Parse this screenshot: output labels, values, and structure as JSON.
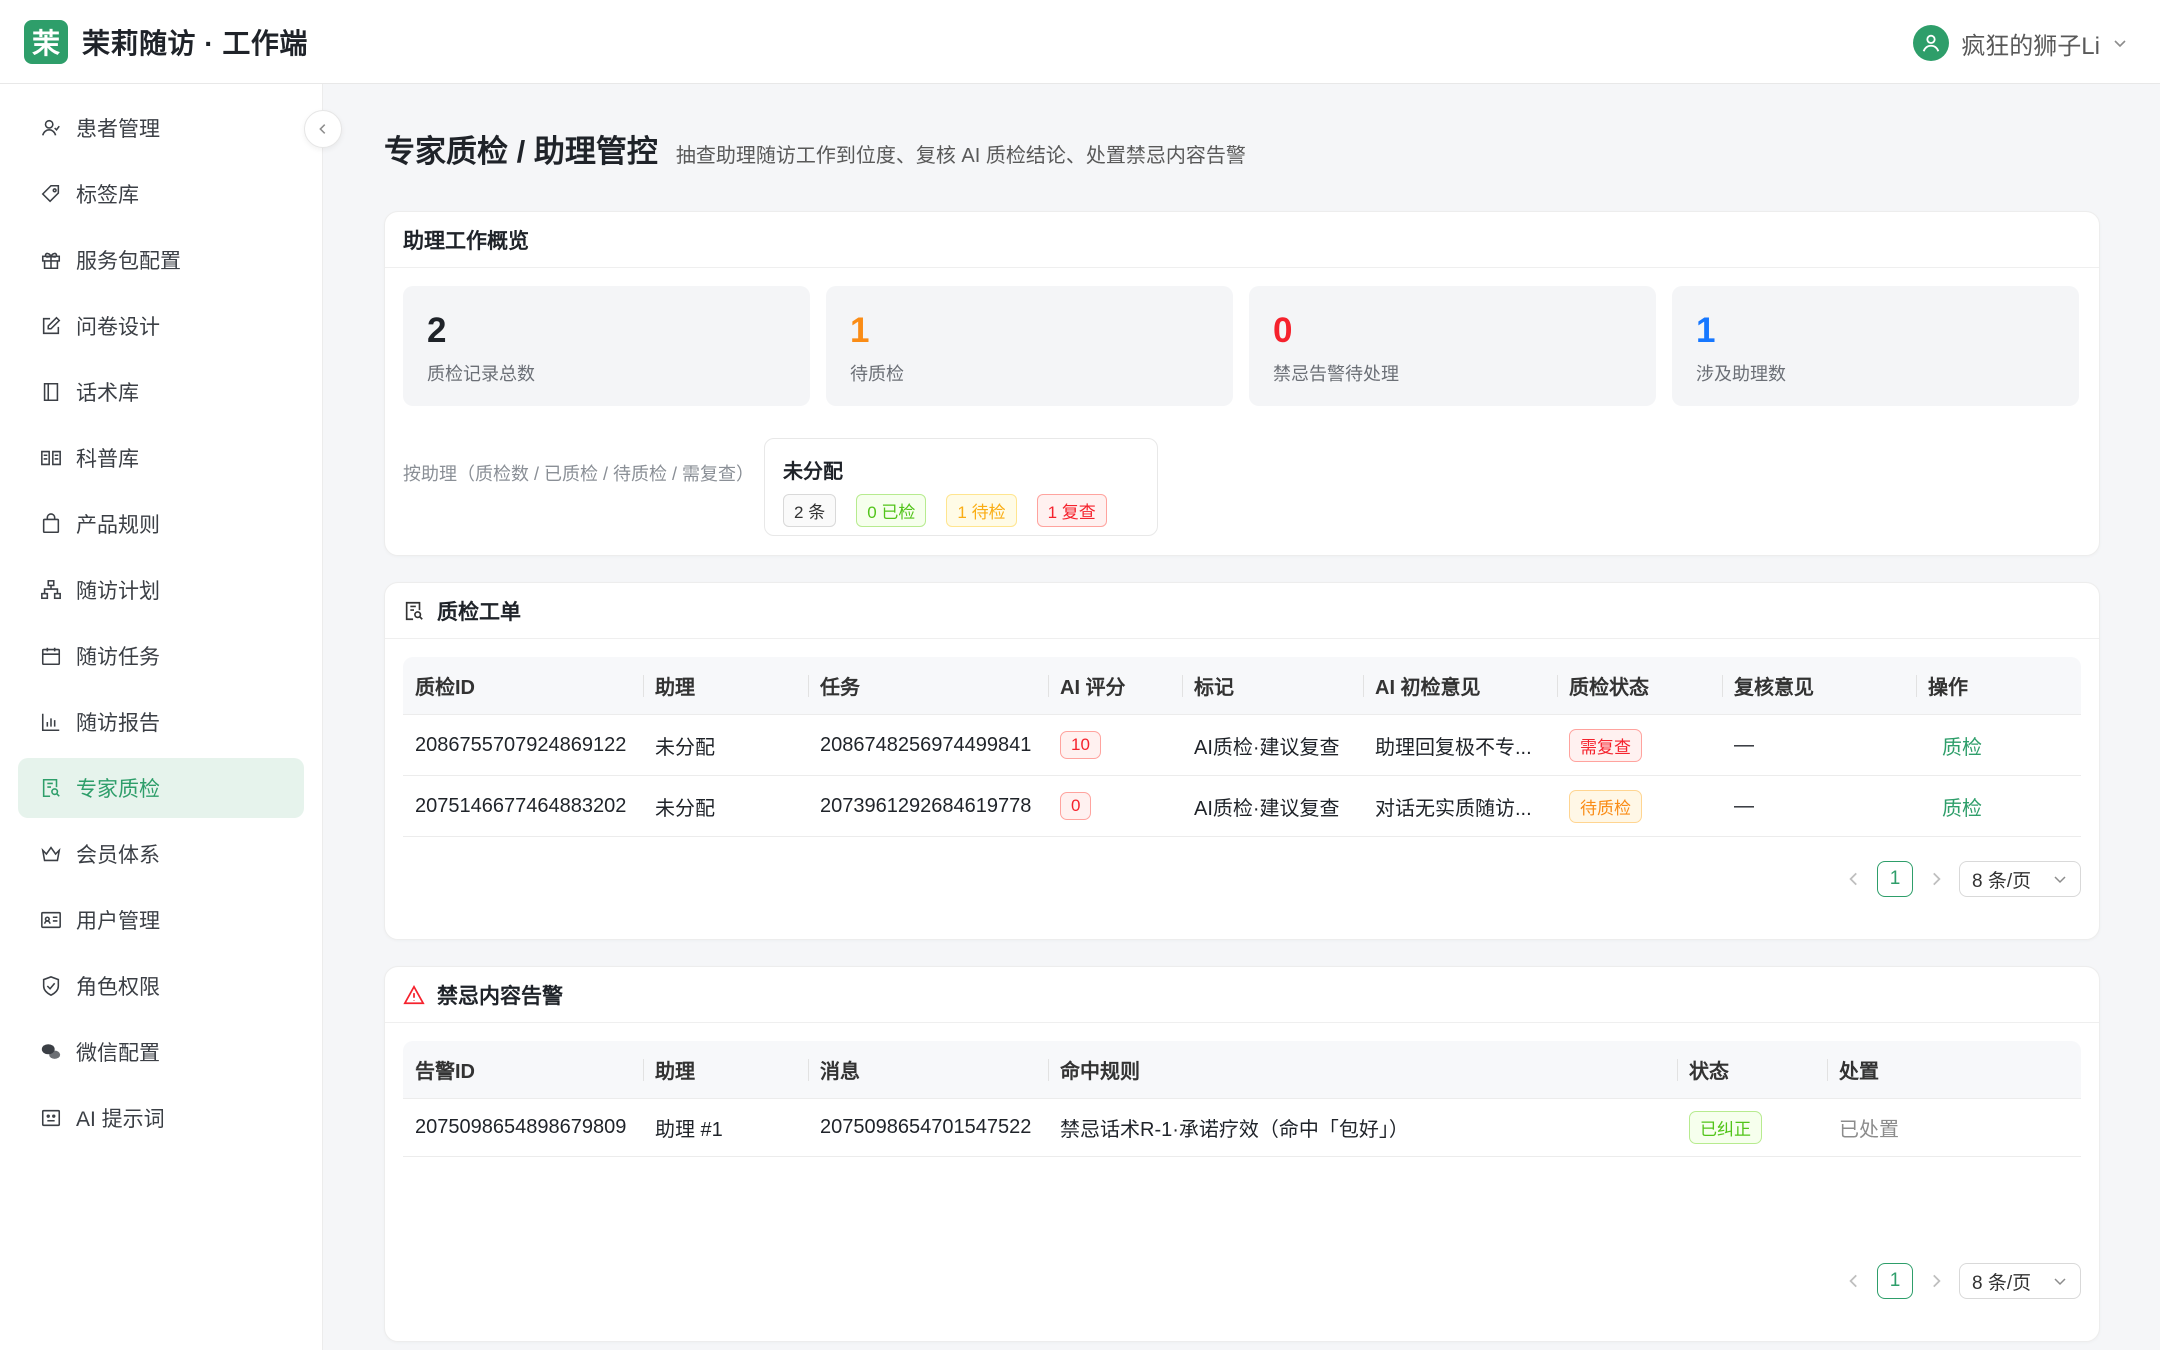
{
  "header": {
    "logo_char": "茉",
    "app_title": "茉莉随访 · 工作端",
    "user_name": "疯狂的狮子Li",
    "brand_color": "#2e9e6a"
  },
  "sidebar": {
    "items": [
      {
        "label": "患者管理",
        "icon": "patient-icon"
      },
      {
        "label": "标签库",
        "icon": "tag-icon"
      },
      {
        "label": "服务包配置",
        "icon": "gift-icon"
      },
      {
        "label": "问卷设计",
        "icon": "edit-icon"
      },
      {
        "label": "话术库",
        "icon": "book-icon"
      },
      {
        "label": "科普库",
        "icon": "read-icon"
      },
      {
        "label": "产品规则",
        "icon": "bag-icon"
      },
      {
        "label": "随访计划",
        "icon": "cluster-icon"
      },
      {
        "label": "随访任务",
        "icon": "calendar-icon"
      },
      {
        "label": "随访报告",
        "icon": "bar-chart-icon"
      },
      {
        "label": "专家质检",
        "icon": "audit-icon",
        "active": true
      },
      {
        "label": "会员体系",
        "icon": "crown-icon"
      },
      {
        "label": "用户管理",
        "icon": "idcard-icon"
      },
      {
        "label": "角色权限",
        "icon": "shield-icon"
      },
      {
        "label": "微信配置",
        "icon": "wechat-icon"
      },
      {
        "label": "AI 提示词",
        "icon": "robot-icon"
      }
    ]
  },
  "page": {
    "title": "专家质检 / 助理管控",
    "subtitle": "抽查助理随访工作到位度、复核 AI 质检结论、处置禁忌内容告警"
  },
  "overview": {
    "title": "助理工作概览",
    "stats": [
      {
        "value": "2",
        "label": "质检记录总数",
        "color": "#1f2329"
      },
      {
        "value": "1",
        "label": "待质检",
        "color": "#fa8c16"
      },
      {
        "value": "0",
        "label": "禁忌告警待处理",
        "color": "#f5222d"
      },
      {
        "value": "1",
        "label": "涉及助理数",
        "color": "#1677ff"
      }
    ],
    "by_assistant_label": "按助理（质检数 / 已质检 / 待质检 / 需复查）",
    "assistant": {
      "name": "未分配",
      "count": "2 条",
      "checked": "0 已检",
      "pending": "1 待检",
      "review": "1 复查"
    }
  },
  "qc_orders": {
    "title": "质检工单",
    "columns": [
      "质检ID",
      "助理",
      "任务",
      "AI 评分",
      "标记",
      "AI 初检意见",
      "质检状态",
      "复核意见",
      "操作"
    ],
    "rows": [
      {
        "id": "2086755707924869122",
        "assistant": "未分配",
        "task": "2086748256974499841",
        "score": "10",
        "mark": "AI质检·建议复查",
        "opinion": "助理回复极不专...",
        "status": "需复查",
        "status_type": "red",
        "review": "—",
        "action": "质检"
      },
      {
        "id": "2075146677464883202",
        "assistant": "未分配",
        "task": "2073961292684619778",
        "score": "0",
        "mark": "AI质检·建议复查",
        "opinion": "对话无实质随访...",
        "status": "待质检",
        "status_type": "orange",
        "review": "—",
        "action": "质检"
      }
    ],
    "pagination": {
      "page": "1",
      "page_size": "8 条/页"
    }
  },
  "alerts": {
    "title": "禁忌内容告警",
    "columns": [
      "告警ID",
      "助理",
      "消息",
      "命中规则",
      "状态",
      "处置"
    ],
    "rows": [
      {
        "id": "2075098654898679809",
        "assistant": "助理 #1",
        "message": "2075098654701547522",
        "rule": "禁忌话术R-1·承诺疗效（命中「包好」）",
        "status": "已纠正",
        "handle": "已处置"
      }
    ],
    "pagination": {
      "page": "1",
      "page_size": "8 条/页"
    }
  }
}
